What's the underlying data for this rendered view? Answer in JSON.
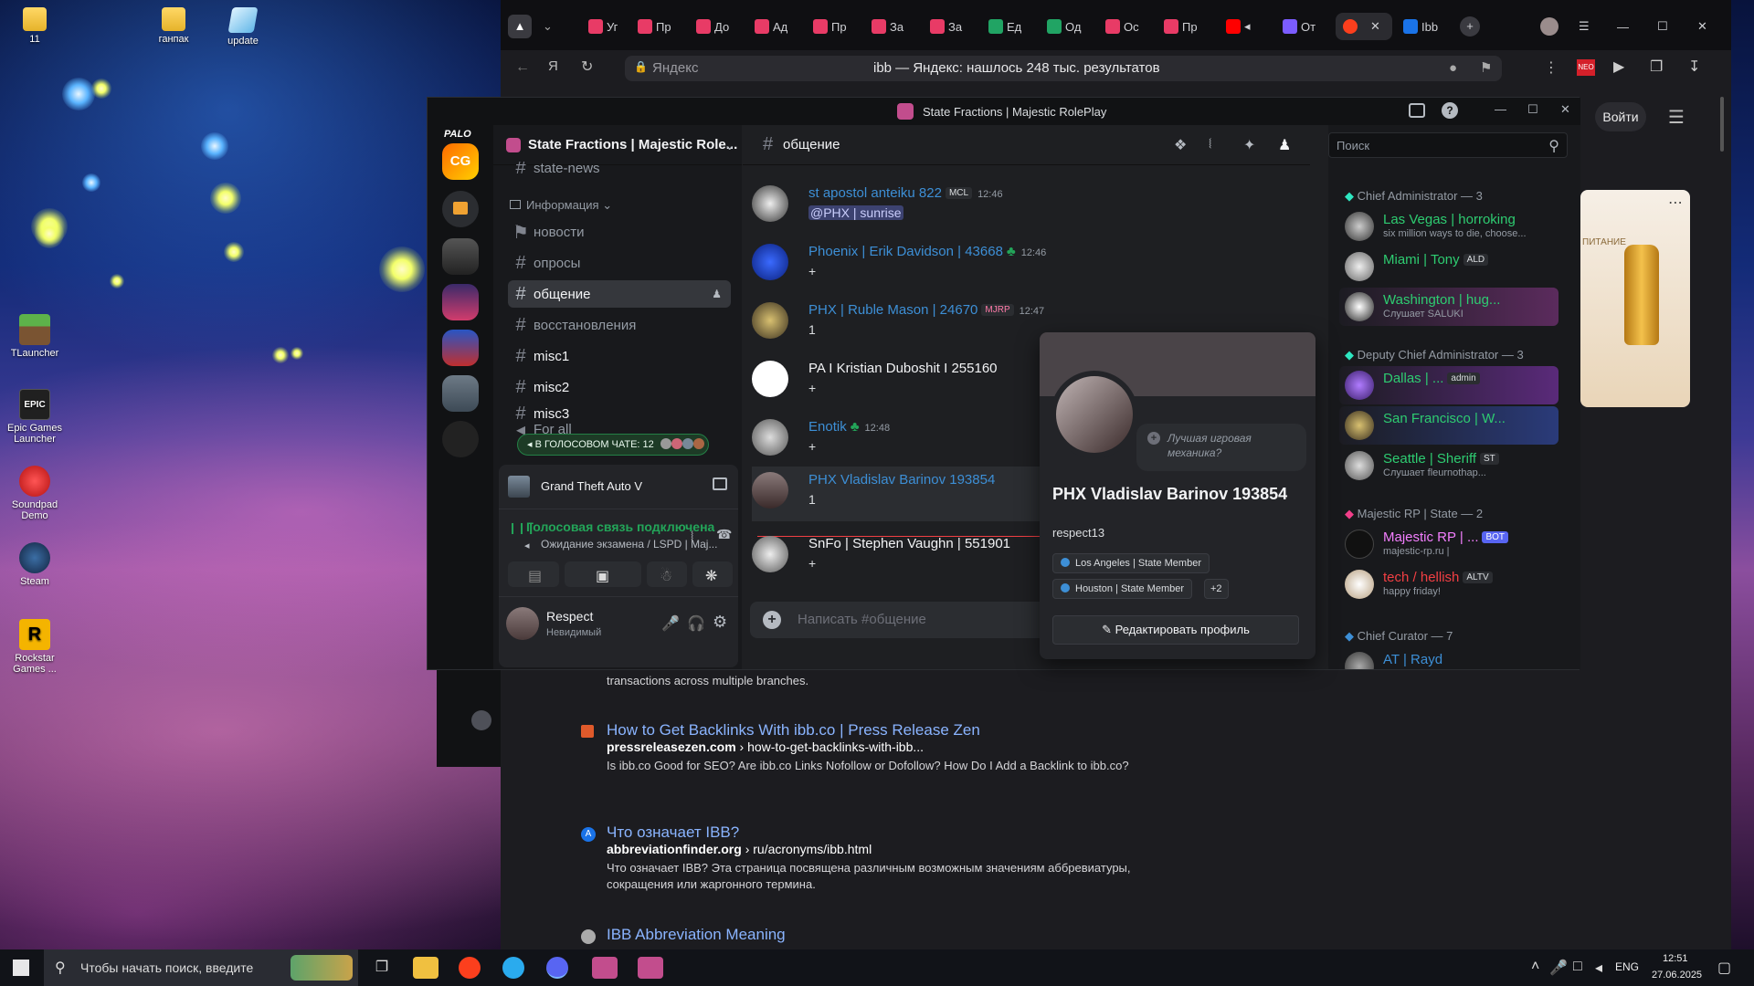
{
  "desktop": {
    "icons": [
      {
        "label": "11"
      },
      {
        "label": "ганпак"
      },
      {
        "label": "update"
      },
      {
        "label": "TLauncher"
      },
      {
        "label": "Epic Games Launcher"
      },
      {
        "label": "Soundpad Demo"
      },
      {
        "label": "Steam"
      },
      {
        "label": "Rockstar Games ..."
      }
    ]
  },
  "browser": {
    "tabs": [
      "Уг",
      "Пр",
      "До",
      "Ад",
      "Пр",
      "За",
      "За",
      "Ед",
      "Од",
      "Ос",
      "Пр",
      "От",
      "Ibb"
    ],
    "address_placeholder": "Яндекс",
    "address_title": "ibb — Яндекс: нашлось 248 тыс. результатов",
    "login_button": "Войти",
    "results": [
      {
        "snippet_tail": "transactions across multiple branches."
      },
      {
        "title": "How to Get Backlinks With ibb.co | Press Release Zen",
        "host": "pressreleasezen.com",
        "path": "› how-to-get-backlinks-with-ibb...",
        "snippet": "Is ibb.co Good for SEO? Are ibb.co Links Nofollow or Dofollow? How Do I Add a Backlink to ibb.co?"
      },
      {
        "title": "Что означает IBB?",
        "host": "abbreviationfinder.org",
        "path": "› ru/acronyms/ibb.html",
        "snippet": "Что означает IBB? Эта страница посвящена различным возможным значениям аббревиатуры, сокращения или жаргонного термина."
      },
      {
        "title": "IBB Abbreviation Meaning"
      }
    ],
    "ad_text": "ПИТАНИЕ"
  },
  "discord": {
    "window_title": "State Fractions | Majestic RolePlay",
    "server_name": "State Fractions | Majestic Role...",
    "channel_name": "общение",
    "search_placeholder": "Поиск",
    "category_info": "Информация",
    "channels": [
      {
        "name": "state-news"
      },
      {
        "name": "новости"
      },
      {
        "name": "опросы"
      },
      {
        "name": "общение"
      },
      {
        "name": "восстановления"
      },
      {
        "name": "misc1"
      },
      {
        "name": "misc2"
      },
      {
        "name": "misc3"
      },
      {
        "name": "For all"
      }
    ],
    "voice_banner": "В ГОЛОСОВОМ ЧАТЕ: 12",
    "activity_game": "Grand Theft Auto V",
    "voice_status": "Голосовая связь подключена",
    "voice_channel": "Ожидание экзамена / LSPD | Maj...",
    "user_name": "Respect",
    "user_status": "Невидимый",
    "messages": [
      {
        "author": "st apostol anteiku 822",
        "badge": "MCL",
        "time": "12:46",
        "text": "@PHX | sunrise",
        "color": "#3d8fd6"
      },
      {
        "author": "Phoenix | Erik Davidson | 43668",
        "badge": "",
        "time": "12:46",
        "text": "+",
        "color": "#3d8fd6"
      },
      {
        "author": "PHX | Ruble Mason | 24670",
        "badge": "MJRP",
        "time": "12:47",
        "text": "1",
        "color": "#3d8fd6"
      },
      {
        "author": "PA I Kristian Duboshit I 255160",
        "badge": "",
        "time": "",
        "text": "+",
        "color": "#f2f3f5"
      },
      {
        "author": "Enotik",
        "badge": "",
        "time": "12:48",
        "text": "+",
        "color": "#3d8fd6"
      },
      {
        "author": "PHX  Vladislav Barinov 193854",
        "badge": "",
        "time": "",
        "text": "1",
        "color": "#3d8fd6"
      },
      {
        "author": "SnFo | Stephen Vaughn | 551901",
        "badge": "",
        "time": "",
        "text": "+",
        "color": "#f2f3f5"
      }
    ],
    "composer_placeholder": "Написать #общение",
    "member_groups": [
      {
        "title": "Chief Administrator — 3",
        "members": [
          {
            "name": "Las Vegas | horroking",
            "status": "six million ways to die, choose...",
            "color": "#2ecc71"
          },
          {
            "name": "Miami | Tony",
            "tag": "ALD",
            "status": "",
            "color": "#2ecc71"
          },
          {
            "name": "Washington | hug...",
            "status": "Слушает SALUKI",
            "color": "#2ecc71"
          }
        ]
      },
      {
        "title": "Deputy Chief Administrator — 3",
        "members": [
          {
            "name": "Dallas | ...",
            "tag": "admin",
            "status": "",
            "color": "#2ecc71"
          },
          {
            "name": "San Francisco | W...",
            "status": "",
            "color": "#2ecc71"
          },
          {
            "name": "Seattle | Sheriff",
            "tag": "ST",
            "status": "Слушает fleurnothap...",
            "color": "#2ecc71"
          }
        ]
      },
      {
        "title": "Majestic RP | State — 2",
        "members": [
          {
            "name": "Majestic RP | ...",
            "tag": "BOT",
            "status": "majestic-rp.ru |",
            "color": "#f47fff"
          },
          {
            "name": "tech / hellish",
            "tag": "ALTV",
            "status": "happy friday!",
            "color": "#f23f43"
          }
        ]
      },
      {
        "title": "Chief Curator — 7",
        "members": [
          {
            "name": "AT | Rayd",
            "status": "",
            "color": "#3d8fd6"
          }
        ]
      }
    ],
    "profile": {
      "name": "PHX Vladislav Barinov 193854",
      "username": "respect13",
      "bubble": "Лучшая игровая механика?",
      "roles": [
        "Los Angeles | State Member",
        "Houston | State Member",
        "+2"
      ],
      "edit_button": "Редактировать профиль"
    }
  },
  "taskbar": {
    "search_placeholder": "Чтобы начать поиск, введите",
    "language": "ENG",
    "time": "12:51",
    "date": "27.06.2025"
  }
}
